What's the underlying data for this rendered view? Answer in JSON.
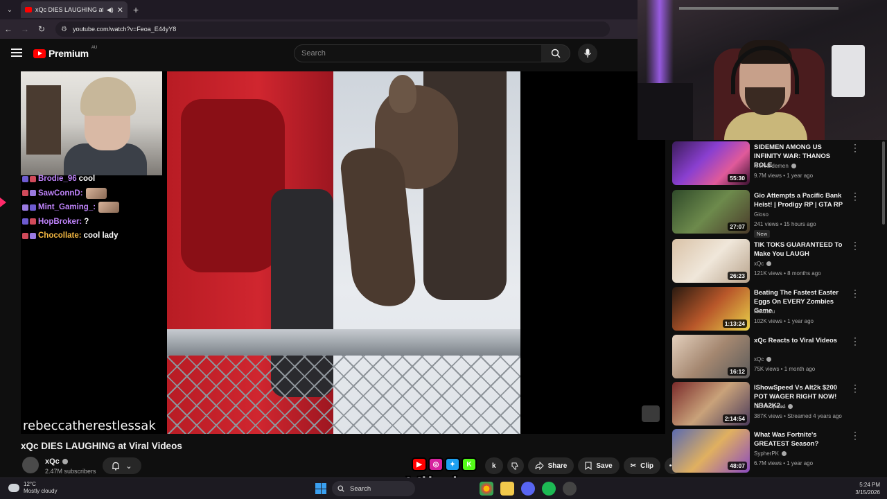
{
  "browser": {
    "tab_title": "xQc DIES LAUGHING at Viral",
    "url": "youtube.com/watch?v=Feoa_E44yY8"
  },
  "youtube": {
    "logo_text": "Premium",
    "region": "AU",
    "search_placeholder": "Search"
  },
  "chat": [
    {
      "user": "Brodie_96",
      "message": "cool",
      "color": "#c084fc",
      "emote": false
    },
    {
      "user": "SawConnD:",
      "message": "",
      "color": "#c084fc",
      "emote": true
    },
    {
      "user": "Mint_Gaming_:",
      "message": "",
      "color": "#c084fc",
      "emote": true
    },
    {
      "user": "HopBroker:",
      "message": "?",
      "color": "#c084fc",
      "emote": false
    },
    {
      "user": "Chocollate:",
      "message": "cool lady",
      "color": "#f5b942",
      "emote": false
    }
  ],
  "video": {
    "watermark": "rebeccatherestlessak",
    "title": "xQc DIES LAUGHING at Viral Videos",
    "channel": "xQc",
    "subscribers": "2.47M subscribers"
  },
  "actions": {
    "like_partial": "k",
    "share": "Share",
    "save": "Save",
    "clip": "Clip"
  },
  "overlay": {
    "brand": "Vibzlo"
  },
  "recommended": [
    {
      "title": "SIDEMEN AMONG US INFINITY WAR: THANOS ROLE",
      "channel": "MoreSidemen",
      "verified": true,
      "meta": "9.7M views • 1 year ago",
      "duration": "55:30",
      "badge": "",
      "thumb": "linear-gradient(135deg,#3b1c5a,#8a3fd0 40%,#e05a9a 70%,#3a1030)"
    },
    {
      "title": "Gio Attempts a Pacific Bank Heist! | Prodigy RP | GTA RP",
      "channel": "Gioso",
      "verified": false,
      "meta": "241 views • 15 hours ago",
      "duration": "27:07",
      "badge": "New",
      "thumb": "linear-gradient(135deg,#2f4a2a,#6d8a4c 50%,#4a3a2a)"
    },
    {
      "title": "TIK TOKS GUARANTEED To Make You LAUGH",
      "channel": "xQc",
      "verified": true,
      "meta": "121K views • 8 months ago",
      "duration": "26:23",
      "badge": "",
      "thumb": "linear-gradient(135deg,#d9c2a7,#f0e7da 50%,#b8a38c)"
    },
    {
      "title": "Beating The Fastest Easter Eggs On EVERY Zombies Game",
      "channel": "Renzaru",
      "verified": false,
      "meta": "102K views • 1 year ago",
      "duration": "1:13:24",
      "badge": "",
      "thumb": "linear-gradient(135deg,#2a1a10,#b8572a 50%,#e9d24a)"
    },
    {
      "title": "xQc Reacts to Viral Videos",
      "channel": "xQc",
      "verified": true,
      "meta": "75K views • 1 month ago",
      "duration": "16:12",
      "badge": "",
      "thumb": "linear-gradient(135deg,#e4d0bd,#a48770 50%,#5a5a5a)"
    },
    {
      "title": "IShowSpeed Vs Alt2k $200 POT WAGER RIGHT NOW! NBA2K2...",
      "channel": "IShowSpeed",
      "verified": true,
      "meta": "387K views • Streamed 4 years ago",
      "duration": "2:14:54",
      "badge": "",
      "thumb": "linear-gradient(135deg,#7a2a2a,#c9a27a 50%,#4a3a5a)"
    },
    {
      "title": "What Was Fortnite's GREATEST Season?",
      "channel": "SypherPK",
      "verified": true,
      "meta": "6.7M views • 1 year ago",
      "duration": "48:07",
      "badge": "",
      "thumb": "linear-gradient(135deg,#5a6ab0,#e0b060 50%,#8a4ac0)"
    }
  ],
  "taskbar": {
    "temp": "12°C",
    "weather": "Mostly cloudy",
    "search": "Search",
    "time": "5:24 PM",
    "date": "3/15/2026"
  }
}
